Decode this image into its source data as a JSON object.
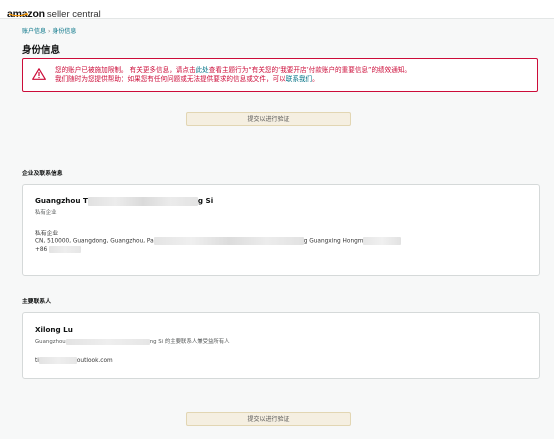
{
  "header": {
    "logo_amazon": "amazon",
    "logo_suffix": "seller central"
  },
  "breadcrumb": {
    "parent": "账户信息",
    "separator": "›",
    "current": "身份信息"
  },
  "page_title": "身份信息",
  "alert": {
    "line1_prefix": "您的账户已被施加限制。 有关更多信息，请点击",
    "line1_link": "此处",
    "line1_suffix": "查看主题行为“有关您的‘我要开店’付款账户的重要信息”的绩效通知。",
    "line2_prefix": "我们随时为您提供帮助：如果您有任何问题或无法提供要求的信息或文件，可以",
    "line2_link": "联系我们",
    "line2_suffix": "。",
    "color": "#cc0c39"
  },
  "verify_button_label": "提交以进行验证",
  "business": {
    "section_label": "企业及联系信息",
    "name_start": "Guangzhou T",
    "name_end": "g Si",
    "type": "私有企业",
    "address_label": "私有企业",
    "address_start": "CN, 510000, Guangdong, Guangzhou, Pa",
    "address_end": "g Guangxing Hongm",
    "phone_prefix": "+86"
  },
  "contact": {
    "section_label": "主要联系人",
    "name": "Xilong Lu",
    "role_start": "Guangzhou",
    "role_end": "ng Si 的主要联系人兼受益所有人",
    "email_start": "ti",
    "email_end": "outlook.com"
  }
}
